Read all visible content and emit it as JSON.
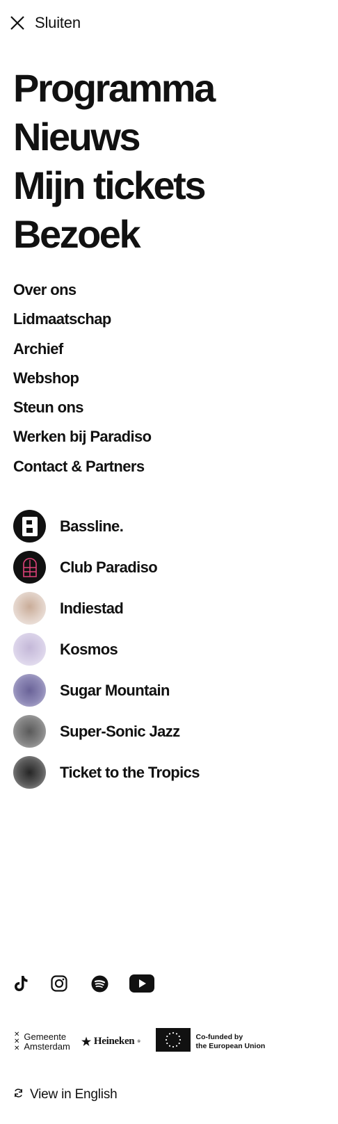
{
  "header": {
    "close_label": "Sluiten",
    "close_icon": "close-icon"
  },
  "primary_nav": [
    {
      "label": "Programma"
    },
    {
      "label": "Nieuws"
    },
    {
      "label": "Mijn tickets"
    },
    {
      "label": "Bezoek"
    }
  ],
  "secondary_nav": [
    {
      "label": "Over ons"
    },
    {
      "label": "Lidmaatschap"
    },
    {
      "label": "Archief"
    },
    {
      "label": "Webshop"
    },
    {
      "label": "Steun ons"
    },
    {
      "label": "Werken bij Paradiso"
    },
    {
      "label": "Contact & Partners"
    }
  ],
  "brands": [
    {
      "label": "Bassline.",
      "icon": "bassline-logo-icon"
    },
    {
      "label": "Club Paradiso",
      "icon": "club-paradiso-logo-icon"
    },
    {
      "label": "Indiestad",
      "icon": "indiestad-gradient-icon"
    },
    {
      "label": "Kosmos",
      "icon": "kosmos-gradient-icon"
    },
    {
      "label": "Sugar Mountain",
      "icon": "sugar-mountain-gradient-icon"
    },
    {
      "label": "Super-Sonic Jazz",
      "icon": "super-sonic-jazz-gradient-icon"
    },
    {
      "label": "Ticket to the Tropics",
      "icon": "ticket-to-the-tropics-gradient-icon"
    }
  ],
  "social": [
    {
      "icon": "tiktok-icon"
    },
    {
      "icon": "instagram-icon"
    },
    {
      "icon": "spotify-icon"
    },
    {
      "icon": "youtube-icon"
    }
  ],
  "sponsors": {
    "amsterdam": {
      "line1": "Gemeente",
      "line2": "Amsterdam"
    },
    "heineken": {
      "label": "Heineken",
      "mark": "®"
    },
    "eu": {
      "line1": "Co-funded by",
      "line2": "the European Union"
    }
  },
  "footer": {
    "language_label": "View in English",
    "language_icon": "refresh-icon"
  },
  "colors": {
    "text": "#111111",
    "background": "#ffffff",
    "club_paradiso_accent": "#e0427a"
  }
}
